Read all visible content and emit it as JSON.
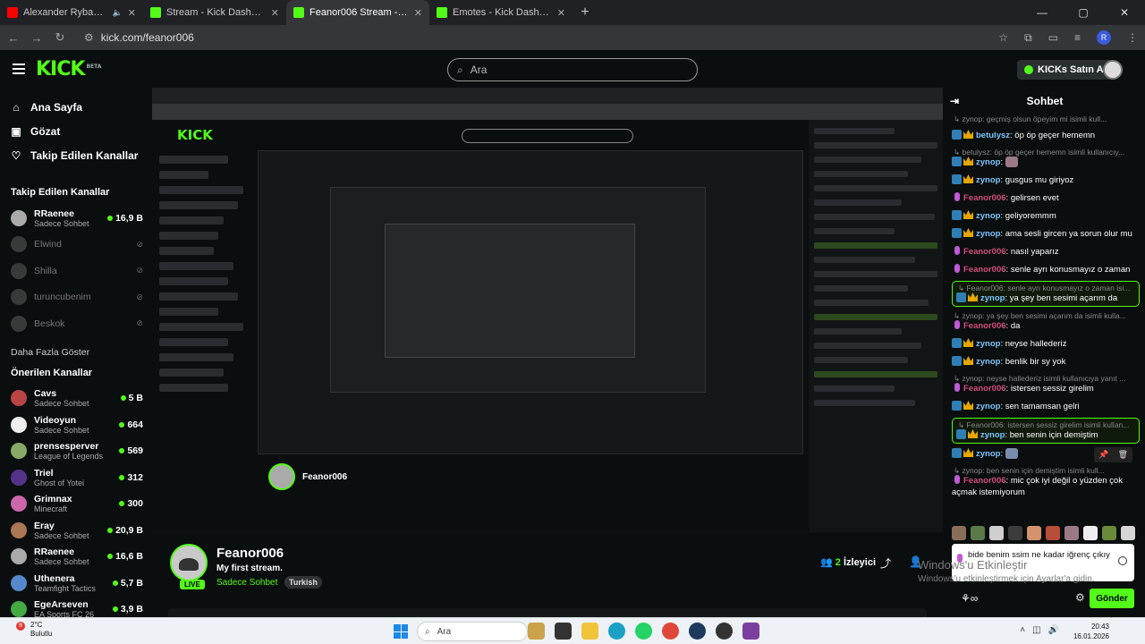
{
  "browser": {
    "tabs": [
      {
        "title": "Alexander Rybak - Fairytale",
        "favicon_color": "#ff0000",
        "active": false
      },
      {
        "title": "Stream - Kick Dashboard",
        "favicon_color": "#53fc18",
        "active": false
      },
      {
        "title": "Feanor006 Stream - Watch Live",
        "favicon_color": "#53fc18",
        "active": true
      },
      {
        "title": "Emotes - Kick Dashboard",
        "favicon_color": "#53fc18",
        "active": false
      }
    ],
    "url": "kick.com/feanor006",
    "profile_initial": "R"
  },
  "header": {
    "logo": "KICK",
    "logo_badge": "BETA",
    "search_placeholder": "Ara",
    "kicks_button": "KICKs Satın Al"
  },
  "sidebar": {
    "nav": [
      {
        "label": "Ana Sayfa",
        "icon": "home-icon"
      },
      {
        "label": "Gözat",
        "icon": "browse-icon"
      },
      {
        "label": "Takip Edilen Kanallar",
        "icon": "heart-icon"
      }
    ],
    "followed_title": "Takip Edilen Kanallar",
    "followed": [
      {
        "name": "RRaenee",
        "category": "Sadece Sohbet",
        "viewers": "16,9 B",
        "live": true
      },
      {
        "name": "Elwind",
        "live": false
      },
      {
        "name": "Shilla",
        "live": false
      },
      {
        "name": "turuncubenim",
        "live": false
      },
      {
        "name": "Beskok",
        "live": false
      }
    ],
    "show_more": "Daha Fazla Göster",
    "recommended_title": "Önerilen Kanallar",
    "recommended": [
      {
        "name": "Cavs",
        "category": "Sadece Sohbet",
        "viewers": "5 B"
      },
      {
        "name": "Videoyun",
        "category": "Sadece Sohbet",
        "viewers": "664"
      },
      {
        "name": "prensesperver",
        "category": "League of Legends",
        "viewers": "569"
      },
      {
        "name": "Triel",
        "category": "Ghost of Yotei",
        "viewers": "312"
      },
      {
        "name": "Grimnax",
        "category": "Minecraft",
        "viewers": "300"
      },
      {
        "name": "Eray",
        "category": "Sadece Sohbet",
        "viewers": "20,9 B"
      },
      {
        "name": "RRaenee",
        "category": "Sadece Sohbet",
        "viewers": "16,6 B"
      },
      {
        "name": "Uthenera",
        "category": "Teamfight Tactics",
        "viewers": "5,7 B"
      },
      {
        "name": "EgeArseven",
        "category": "EA Sports FC 26",
        "viewers": "3,9 B"
      }
    ]
  },
  "stream": {
    "streamer": "Feanor006",
    "title": "My first stream.",
    "category": "Sadece Sohbet",
    "tag": "Turkish",
    "live_label": "LIVE",
    "viewers_count": "2",
    "viewers_label": "İzleyici"
  },
  "chat": {
    "title": "Sohbet",
    "messages": [
      {
        "reply": null,
        "user": "zynop",
        "text": "geçmiş olsun öpeyim mi isimli kull...",
        "kind": "partial"
      },
      {
        "user": "betulysz",
        "text": "öp öp geçer hememn",
        "kind": "sub"
      },
      {
        "reply": "betulysz: öp öp geçer hememn isimli kullanıcıy...",
        "user": "zynop",
        "text": "",
        "emote": true,
        "kind": "sub"
      },
      {
        "user": "zynop",
        "text": "gusgus mu giriyoz",
        "kind": "sub"
      },
      {
        "user": "Feanor006",
        "text": "gelirsen evet",
        "kind": "owner"
      },
      {
        "user": "zynop",
        "text": "geliyoremmm",
        "kind": "sub"
      },
      {
        "user": "zynop",
        "text": "ama sesli gircen ya sorun olur mu",
        "kind": "sub"
      },
      {
        "user": "Feanor006",
        "text": "nasıl yaparız",
        "kind": "owner"
      },
      {
        "user": "Feanor006",
        "text": "senle ayrı konusmayız o zaman",
        "kind": "owner"
      },
      {
        "reply": "Feanor006: senle ayrı konusmayız o zaman isi...",
        "user": "zynop",
        "text": "ya şey ben sesimi açarım da",
        "kind": "sub",
        "highlight": true
      },
      {
        "reply": "zynop: ya şey ben sesimi açarım da isimli kulla...",
        "user": "Feanor006",
        "text": "da",
        "kind": "owner"
      },
      {
        "user": "zynop",
        "text": "neyse hallederiz",
        "kind": "sub"
      },
      {
        "user": "zynop",
        "text": "benlik bir sy yok",
        "kind": "sub"
      },
      {
        "reply": "zynop: neyse hallederiz isimli kullanıcıya yanıt ...",
        "user": "Feanor006",
        "text": "istersen sessiz girelim",
        "kind": "owner"
      },
      {
        "user": "zynop",
        "text": "sen tamamsan gelri",
        "kind": "sub"
      },
      {
        "reply": "Feanor006: istersen sessiz girelim isimli kullan...",
        "user": "zynop",
        "text": "ben senin için demiştim",
        "kind": "sub",
        "highlight": true
      },
      {
        "user": "zynop",
        "text": "",
        "emote": true,
        "kind": "sub"
      },
      {
        "reply": "zynop: ben senin için demiştim isimli kull...",
        "user": "Feanor006",
        "text": "mic çok iyi değil o yüzden çok açmak istemiyorum",
        "kind": "owner"
      }
    ],
    "input_text": "bide benim ssim ne kadar iğrenç çıkıy",
    "send_label": "Gönder"
  },
  "watermark": {
    "line1": "Windows'u Etkinleştir",
    "line2": "Windows'u etkinleştirmek için Ayarlar'a gidin."
  },
  "taskbar": {
    "weather_temp": "2°C",
    "weather_desc": "Bulutlu",
    "notification_count": "9",
    "search_placeholder": "Ara",
    "time": "20:43",
    "date": "16.01.2026"
  }
}
